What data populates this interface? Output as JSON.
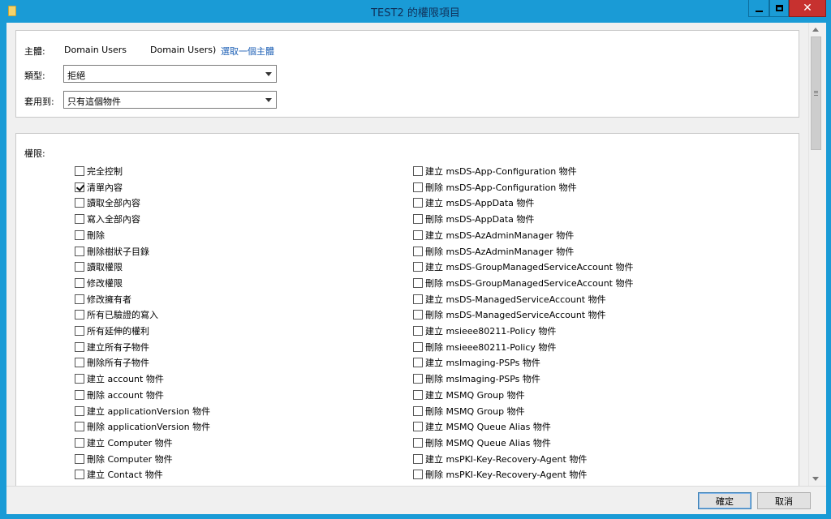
{
  "window": {
    "title": "TEST2 的權限項目"
  },
  "principal": {
    "label": "主體:",
    "name": "Domain Users",
    "detail": "Domain Users)",
    "select_link": "選取一個主體"
  },
  "type": {
    "label": "類型:",
    "value": "拒絕"
  },
  "applies_to": {
    "label": "套用到:",
    "value": "只有這個物件"
  },
  "permissions": {
    "label": "權限:",
    "left": [
      {
        "label": "完全控制",
        "checked": false
      },
      {
        "label": "清單內容",
        "checked": true
      },
      {
        "label": "讀取全部內容",
        "checked": false
      },
      {
        "label": "寫入全部內容",
        "checked": false
      },
      {
        "label": "刪除",
        "checked": false
      },
      {
        "label": "刪除樹狀子目錄",
        "checked": false
      },
      {
        "label": "讀取權限",
        "checked": false
      },
      {
        "label": "修改權限",
        "checked": false
      },
      {
        "label": "修改擁有者",
        "checked": false
      },
      {
        "label": "所有已驗證的寫入",
        "checked": false
      },
      {
        "label": "所有延伸的權利",
        "checked": false
      },
      {
        "label": "建立所有子物件",
        "checked": false
      },
      {
        "label": "刪除所有子物件",
        "checked": false
      },
      {
        "label": "建立 account 物件",
        "checked": false
      },
      {
        "label": "刪除 account 物件",
        "checked": false
      },
      {
        "label": "建立 applicationVersion 物件",
        "checked": false
      },
      {
        "label": "刪除 applicationVersion 物件",
        "checked": false
      },
      {
        "label": "建立 Computer 物件",
        "checked": false
      },
      {
        "label": "刪除 Computer 物件",
        "checked": false
      },
      {
        "label": "建立 Contact 物件",
        "checked": false
      }
    ],
    "right": [
      {
        "label": "建立 msDS-App-Configuration 物件",
        "checked": false
      },
      {
        "label": "刪除 msDS-App-Configuration 物件",
        "checked": false
      },
      {
        "label": "建立 msDS-AppData 物件",
        "checked": false
      },
      {
        "label": "刪除 msDS-AppData 物件",
        "checked": false
      },
      {
        "label": "建立 msDS-AzAdminManager 物件",
        "checked": false
      },
      {
        "label": "刪除 msDS-AzAdminManager 物件",
        "checked": false
      },
      {
        "label": "建立 msDS-GroupManagedServiceAccount 物件",
        "checked": false
      },
      {
        "label": "刪除 msDS-GroupManagedServiceAccount 物件",
        "checked": false
      },
      {
        "label": "建立 msDS-ManagedServiceAccount 物件",
        "checked": false
      },
      {
        "label": "刪除 msDS-ManagedServiceAccount 物件",
        "checked": false
      },
      {
        "label": "建立 msieee80211-Policy 物件",
        "checked": false
      },
      {
        "label": "刪除 msieee80211-Policy 物件",
        "checked": false
      },
      {
        "label": "建立 msImaging-PSPs 物件",
        "checked": false
      },
      {
        "label": "刪除 msImaging-PSPs 物件",
        "checked": false
      },
      {
        "label": "建立 MSMQ Group 物件",
        "checked": false
      },
      {
        "label": "刪除 MSMQ Group 物件",
        "checked": false
      },
      {
        "label": "建立 MSMQ Queue Alias 物件",
        "checked": false
      },
      {
        "label": "刪除 MSMQ Queue Alias 物件",
        "checked": false
      },
      {
        "label": "建立 msPKI-Key-Recovery-Agent 物件",
        "checked": false
      },
      {
        "label": "刪除 msPKI-Key-Recovery-Agent 物件",
        "checked": false
      }
    ]
  },
  "buttons": {
    "ok": "確定",
    "cancel": "取消"
  },
  "colors": {
    "titlebar": "#1a9bd6",
    "close": "#c7312f",
    "link": "#1c5fb5"
  }
}
